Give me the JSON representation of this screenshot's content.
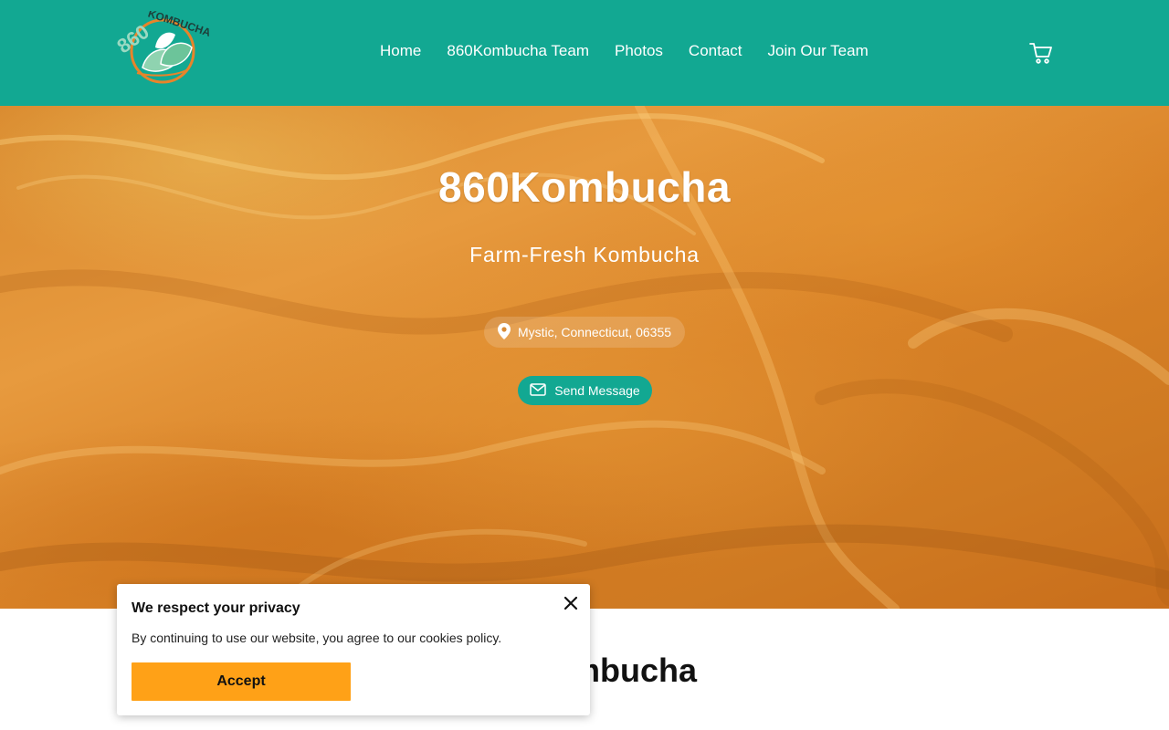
{
  "brand": {
    "logo_text": "860 KOMBUCHA",
    "accent": "#12a892"
  },
  "nav": {
    "items": [
      "Home",
      "860Kombucha Team",
      "Photos",
      "Contact",
      "Join Our Team"
    ]
  },
  "header_icons": [
    "cart-icon"
  ],
  "hero": {
    "title": "860Kombucha",
    "subtitle": "Farm-Fresh Kombucha",
    "location": "Mystic, Connecticut, 06355",
    "send_label": "Send Message"
  },
  "section": {
    "title": "860Kombucha"
  },
  "cookie": {
    "title": "We respect your privacy",
    "text": "By continuing to use our website, you agree to our cookies policy.",
    "accept_label": "Accept",
    "button_color": "#ffa117"
  }
}
